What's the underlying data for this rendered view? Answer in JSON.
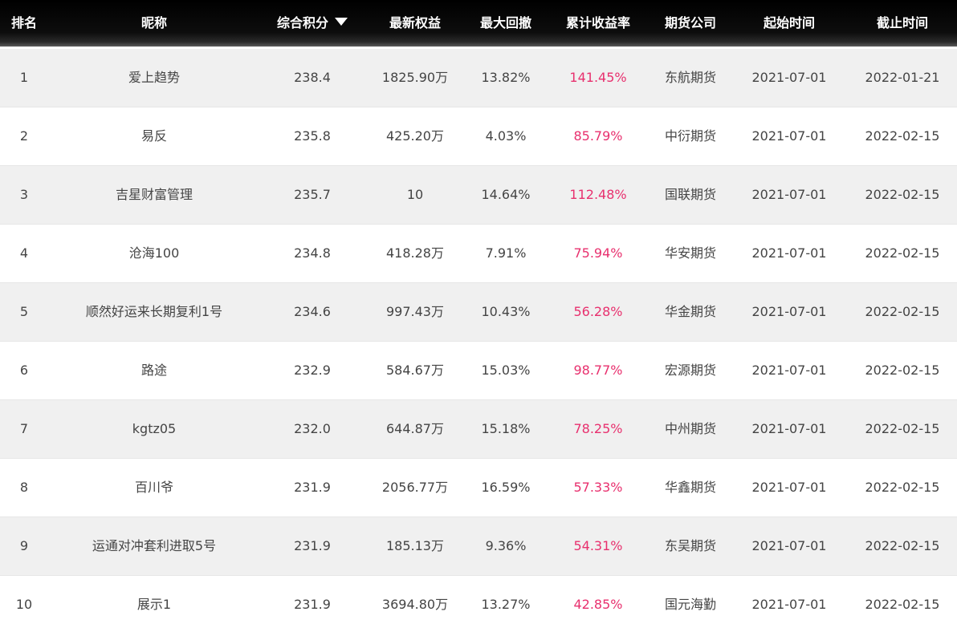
{
  "headers": {
    "rank": "排名",
    "name": "昵称",
    "score": "综合积分",
    "equity": "最新权益",
    "drawdown": "最大回撤",
    "return": "累计收益率",
    "broker": "期货公司",
    "start": "起始时间",
    "end": "截止时间"
  },
  "sort_icon": "caret-down-icon",
  "colors": {
    "header_bg": "#000000",
    "row_alt_bg": "#f0f0f0",
    "return_color": "#e8306e",
    "text_color": "#444444"
  },
  "rows": [
    {
      "rank": "1",
      "name": "爱上趋势",
      "score": "238.4",
      "equity": "1825.90万",
      "drawdown": "13.82%",
      "return": "141.45%",
      "broker": "东航期货",
      "start": "2021-07-01",
      "end": "2022-01-21"
    },
    {
      "rank": "2",
      "name": "易反",
      "score": "235.8",
      "equity": "425.20万",
      "drawdown": "4.03%",
      "return": "85.79%",
      "broker": "中衍期货",
      "start": "2021-07-01",
      "end": "2022-02-15"
    },
    {
      "rank": "3",
      "name": "吉星财富管理",
      "score": "235.7",
      "equity": "10",
      "drawdown": "14.64%",
      "return": "112.48%",
      "broker": "国联期货",
      "start": "2021-07-01",
      "end": "2022-02-15"
    },
    {
      "rank": "4",
      "name": "沧海100",
      "score": "234.8",
      "equity": "418.28万",
      "drawdown": "7.91%",
      "return": "75.94%",
      "broker": "华安期货",
      "start": "2021-07-01",
      "end": "2022-02-15"
    },
    {
      "rank": "5",
      "name": "顺然好运来长期复利1号",
      "score": "234.6",
      "equity": "997.43万",
      "drawdown": "10.43%",
      "return": "56.28%",
      "broker": "华金期货",
      "start": "2021-07-01",
      "end": "2022-02-15"
    },
    {
      "rank": "6",
      "name": "路途",
      "score": "232.9",
      "equity": "584.67万",
      "drawdown": "15.03%",
      "return": "98.77%",
      "broker": "宏源期货",
      "start": "2021-07-01",
      "end": "2022-02-15"
    },
    {
      "rank": "7",
      "name": "kgtz05",
      "score": "232.0",
      "equity": "644.87万",
      "drawdown": "15.18%",
      "return": "78.25%",
      "broker": "中州期货",
      "start": "2021-07-01",
      "end": "2022-02-15"
    },
    {
      "rank": "8",
      "name": "百川爷",
      "score": "231.9",
      "equity": "2056.77万",
      "drawdown": "16.59%",
      "return": "57.33%",
      "broker": "华鑫期货",
      "start": "2021-07-01",
      "end": "2022-02-15"
    },
    {
      "rank": "9",
      "name": "运通对冲套利进取5号",
      "score": "231.9",
      "equity": "185.13万",
      "drawdown": "9.36%",
      "return": "54.31%",
      "broker": "东吴期货",
      "start": "2021-07-01",
      "end": "2022-02-15"
    },
    {
      "rank": "10",
      "name": "展示1",
      "score": "231.9",
      "equity": "3694.80万",
      "drawdown": "13.27%",
      "return": "42.85%",
      "broker": "国元海勤",
      "start": "2021-07-01",
      "end": "2022-02-15"
    }
  ]
}
